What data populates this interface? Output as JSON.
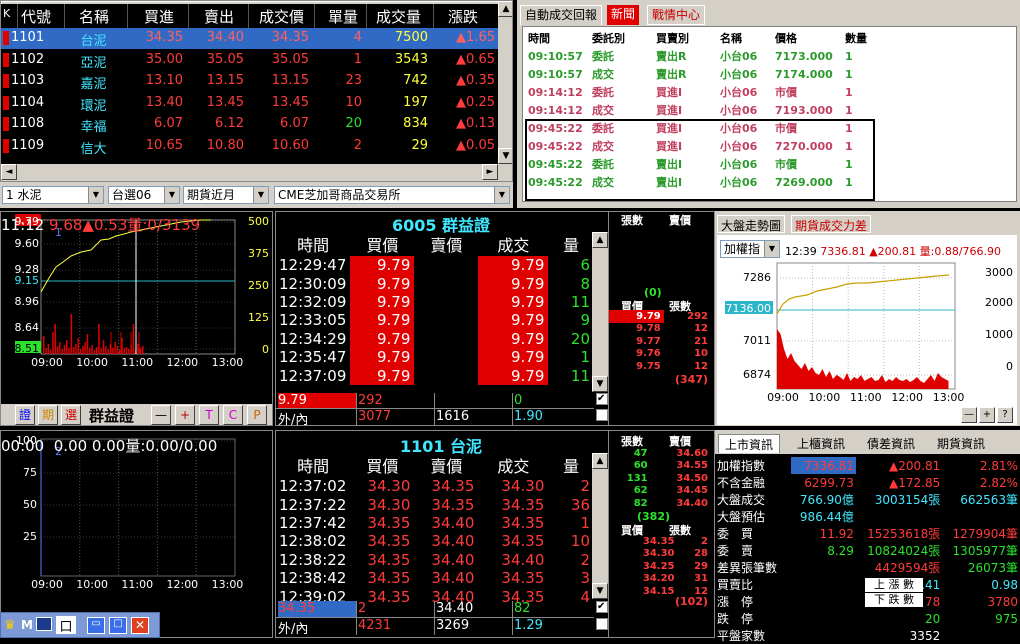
{
  "quote": {
    "headers": [
      "K",
      "代號",
      "名稱",
      "買進",
      "賣出",
      "成交價",
      "單量",
      "成交量",
      "漲跌"
    ],
    "rows": [
      {
        "code": "1101",
        "name": "台泥",
        "bid": "34.35",
        "ask": "34.40",
        "last": "34.35",
        "vol": "4",
        "total": "7500",
        "chg": "▲1.65",
        "selected": true
      },
      {
        "code": "1102",
        "name": "亞泥",
        "bid": "35.00",
        "ask": "35.05",
        "last": "35.05",
        "vol": "1",
        "total": "3543",
        "chg": "▲0.65",
        "selected": false
      },
      {
        "code": "1103",
        "name": "嘉泥",
        "bid": "13.10",
        "ask": "13.15",
        "last": "13.15",
        "vol": "23",
        "total": "742",
        "chg": "▲0.35",
        "selected": false
      },
      {
        "code": "1104",
        "name": "環泥",
        "bid": "13.40",
        "ask": "13.45",
        "last": "13.45",
        "vol": "10",
        "total": "197",
        "chg": "▲0.25",
        "selected": false
      },
      {
        "code": "1108",
        "name": "幸福",
        "bid": "6.07",
        "ask": "6.12",
        "last": "6.07",
        "vol": "20",
        "total": "834",
        "chg": "▲0.13",
        "selected": false
      },
      {
        "code": "1109",
        "name": "信大",
        "bid": "10.65",
        "ask": "10.80",
        "last": "10.60",
        "vol": "2",
        "total": "29",
        "chg": "▲0.05",
        "selected": false
      }
    ]
  },
  "filters": {
    "group": "1 水泥",
    "select": "台選06",
    "futures": "期貨近月",
    "exchange": "CME芝加哥商品交易所"
  },
  "news": {
    "tabs": [
      "自動成交回報",
      "新聞",
      "戰情中心"
    ],
    "headers": [
      "時間",
      "委託別",
      "買賣別",
      "名稱",
      "價格",
      "數量"
    ],
    "rows": [
      {
        "time": "09:10:57",
        "type": "委託",
        "side": "賣出R",
        "name": "小台06",
        "price": "7173.000",
        "qty": "1",
        "color": "grn"
      },
      {
        "time": "09:10:57",
        "type": "成交",
        "side": "賣出R",
        "name": "小台06",
        "price": "7174.000",
        "qty": "1",
        "color": "grn"
      },
      {
        "time": "09:14:12",
        "type": "委託",
        "side": "買進I",
        "name": "小台06",
        "price": "市價",
        "qty": "1",
        "color": "red"
      },
      {
        "time": "09:14:12",
        "type": "成交",
        "side": "買進I",
        "name": "小台06",
        "price": "7193.000",
        "qty": "1",
        "color": "red"
      },
      {
        "time": "09:45:22",
        "type": "委託",
        "side": "買進I",
        "name": "小台06",
        "price": "市價",
        "qty": "1",
        "color": "red"
      },
      {
        "time": "09:45:22",
        "type": "成交",
        "side": "買進I",
        "name": "小台06",
        "price": "7270.000",
        "qty": "1",
        "color": "red"
      },
      {
        "time": "09:45:22",
        "type": "委託",
        "side": "賣出I",
        "name": "小台06",
        "price": "市價",
        "qty": "1",
        "color": "grn"
      },
      {
        "time": "09:45:22",
        "type": "成交",
        "side": "賣出I",
        "name": "小台06",
        "price": "7269.000",
        "qty": "1",
        "color": "grn"
      }
    ]
  },
  "chart1": {
    "header_time": "11:12",
    "header_price": "9.68",
    "header_chg": "▲0.53",
    "header_vol": "量:0/3139",
    "yticks": [
      "9.79",
      "9.60",
      "9.28",
      "9.15",
      "8.96",
      "8.64",
      "8.51"
    ],
    "vticks": [
      "500",
      "375",
      "250",
      "125",
      "0"
    ],
    "xticks": [
      "09:00",
      "10:00",
      "11:00",
      "12:00",
      "13:00"
    ],
    "label": "1"
  },
  "toolbar1": {
    "b1": "證",
    "b2": "期",
    "b3": "選",
    "name": "群益證",
    "minus": "—",
    "plus": "+",
    "t": "T",
    "c": "C",
    "p": "P"
  },
  "ticks1": {
    "title_code": "6005",
    "title_name": "群益證",
    "headers": [
      "時間",
      "買價",
      "賣價",
      "成交",
      "量"
    ],
    "rows": [
      [
        "12:29:47",
        "9.79",
        "",
        "9.79",
        "6"
      ],
      [
        "12:30:09",
        "9.79",
        "",
        "9.79",
        "8"
      ],
      [
        "12:32:09",
        "9.79",
        "",
        "9.79",
        "11"
      ],
      [
        "12:33:05",
        "9.79",
        "",
        "9.79",
        "9"
      ],
      [
        "12:34:29",
        "9.79",
        "",
        "9.79",
        "20"
      ],
      [
        "12:35:47",
        "9.79",
        "",
        "9.79",
        "1"
      ],
      [
        "12:37:09",
        "9.79",
        "",
        "9.79",
        "11"
      ]
    ],
    "foot1": [
      "9.79",
      "292",
      "",
      "0"
    ],
    "foot2": [
      "外/內",
      "3077",
      "1616",
      "1.90"
    ]
  },
  "depth1": {
    "h1": "張數",
    "h2": "賣價",
    "sum_ask": "(0)",
    "bh1": "買價",
    "bh2": "張數",
    "bids": [
      [
        "9.79",
        "292"
      ],
      [
        "9.78",
        "12"
      ],
      [
        "9.77",
        "21"
      ],
      [
        "9.76",
        "10"
      ],
      [
        "9.75",
        "12"
      ]
    ],
    "sum_bid": "(347)"
  },
  "chart2": {
    "tabs": [
      "大盤走勢圖",
      "期貨成交力差"
    ],
    "combo": "加權指",
    "time": "12:39",
    "value": "7336.81",
    "chg": "▲200.81",
    "vol": "量:0.88/766.90",
    "yticks": [
      "7286",
      "7136.00",
      "7011",
      "6874"
    ],
    "vticks": [
      "3000",
      "2000",
      "1000",
      "0"
    ],
    "xticks": [
      "09:00",
      "10:00",
      "11:00",
      "12:00",
      "13:00"
    ]
  },
  "chart3": {
    "header": "00:00  0.00 0.00量:0.00/0.00",
    "label": "2",
    "yticks": [
      "100",
      "75",
      "50",
      "25"
    ],
    "xticks": [
      "09:00",
      "10:00",
      "11:00",
      "12:00",
      "13:00"
    ]
  },
  "ticks2": {
    "title_code": "1101",
    "title_name": "台泥",
    "headers": [
      "時間",
      "買價",
      "賣價",
      "成交",
      "量"
    ],
    "rows": [
      [
        "12:37:02",
        "34.30",
        "34.35",
        "34.30",
        "2"
      ],
      [
        "12:37:22",
        "34.30",
        "34.35",
        "34.35",
        "36"
      ],
      [
        "12:37:42",
        "34.35",
        "34.40",
        "34.35",
        "1"
      ],
      [
        "12:38:02",
        "34.35",
        "34.40",
        "34.35",
        "10"
      ],
      [
        "12:38:22",
        "34.35",
        "34.40",
        "34.40",
        "2"
      ],
      [
        "12:38:42",
        "34.35",
        "34.40",
        "34.35",
        "3"
      ],
      [
        "12:39:02",
        "34.35",
        "34.40",
        "34.35",
        "4"
      ]
    ],
    "foot1": [
      "34.35",
      "2",
      "34.40",
      "82"
    ],
    "foot2": [
      "外/內",
      "4231",
      "3269",
      "1.29"
    ]
  },
  "depth2": {
    "h1": "張數",
    "h2": "賣價",
    "asks": [
      [
        "47",
        "34.60"
      ],
      [
        "60",
        "34.55"
      ],
      [
        "131",
        "34.50"
      ],
      [
        "62",
        "34.45"
      ],
      [
        "82",
        "34.40"
      ]
    ],
    "sum_ask": "(382)",
    "bh1": "買價",
    "bh2": "張數",
    "bids": [
      [
        "34.35",
        "2"
      ],
      [
        "34.30",
        "28"
      ],
      [
        "34.25",
        "29"
      ],
      [
        "34.20",
        "31"
      ],
      [
        "34.15",
        "12"
      ]
    ],
    "sum_bid": "(102)"
  },
  "market": {
    "tabs": [
      "上市資訊",
      "上櫃資訊",
      "債差資訊",
      "期貨資訊"
    ],
    "rows": [
      [
        "加權指數",
        "7336.81",
        "▲200.81",
        "2.81%"
      ],
      [
        "不含金融",
        "6299.73",
        "▲172.85",
        "2.82%"
      ],
      [
        "大盤成交",
        "766.90億",
        "3003154張",
        "662563筆"
      ],
      [
        "大盤預估",
        "986.44億",
        "",
        ""
      ],
      [
        "委　買",
        "11.92",
        "15253618張",
        "1279904筆"
      ],
      [
        "委　賣",
        "8.29",
        "10824024張",
        "1305977筆"
      ],
      [
        "差異張筆數",
        "",
        "4429594張",
        "26073筆"
      ],
      [
        "買賣比",
        "",
        "1.41",
        "0.98"
      ],
      [
        "漲　停",
        "",
        "78",
        "3780"
      ],
      [
        "跌　停",
        "",
        "20",
        "975"
      ],
      [
        "平盤家數",
        "",
        "3352",
        ""
      ]
    ],
    "up_label": "上 漲 數",
    "down_label": "下 跌 數"
  },
  "taskbar": {
    "label": "M"
  }
}
